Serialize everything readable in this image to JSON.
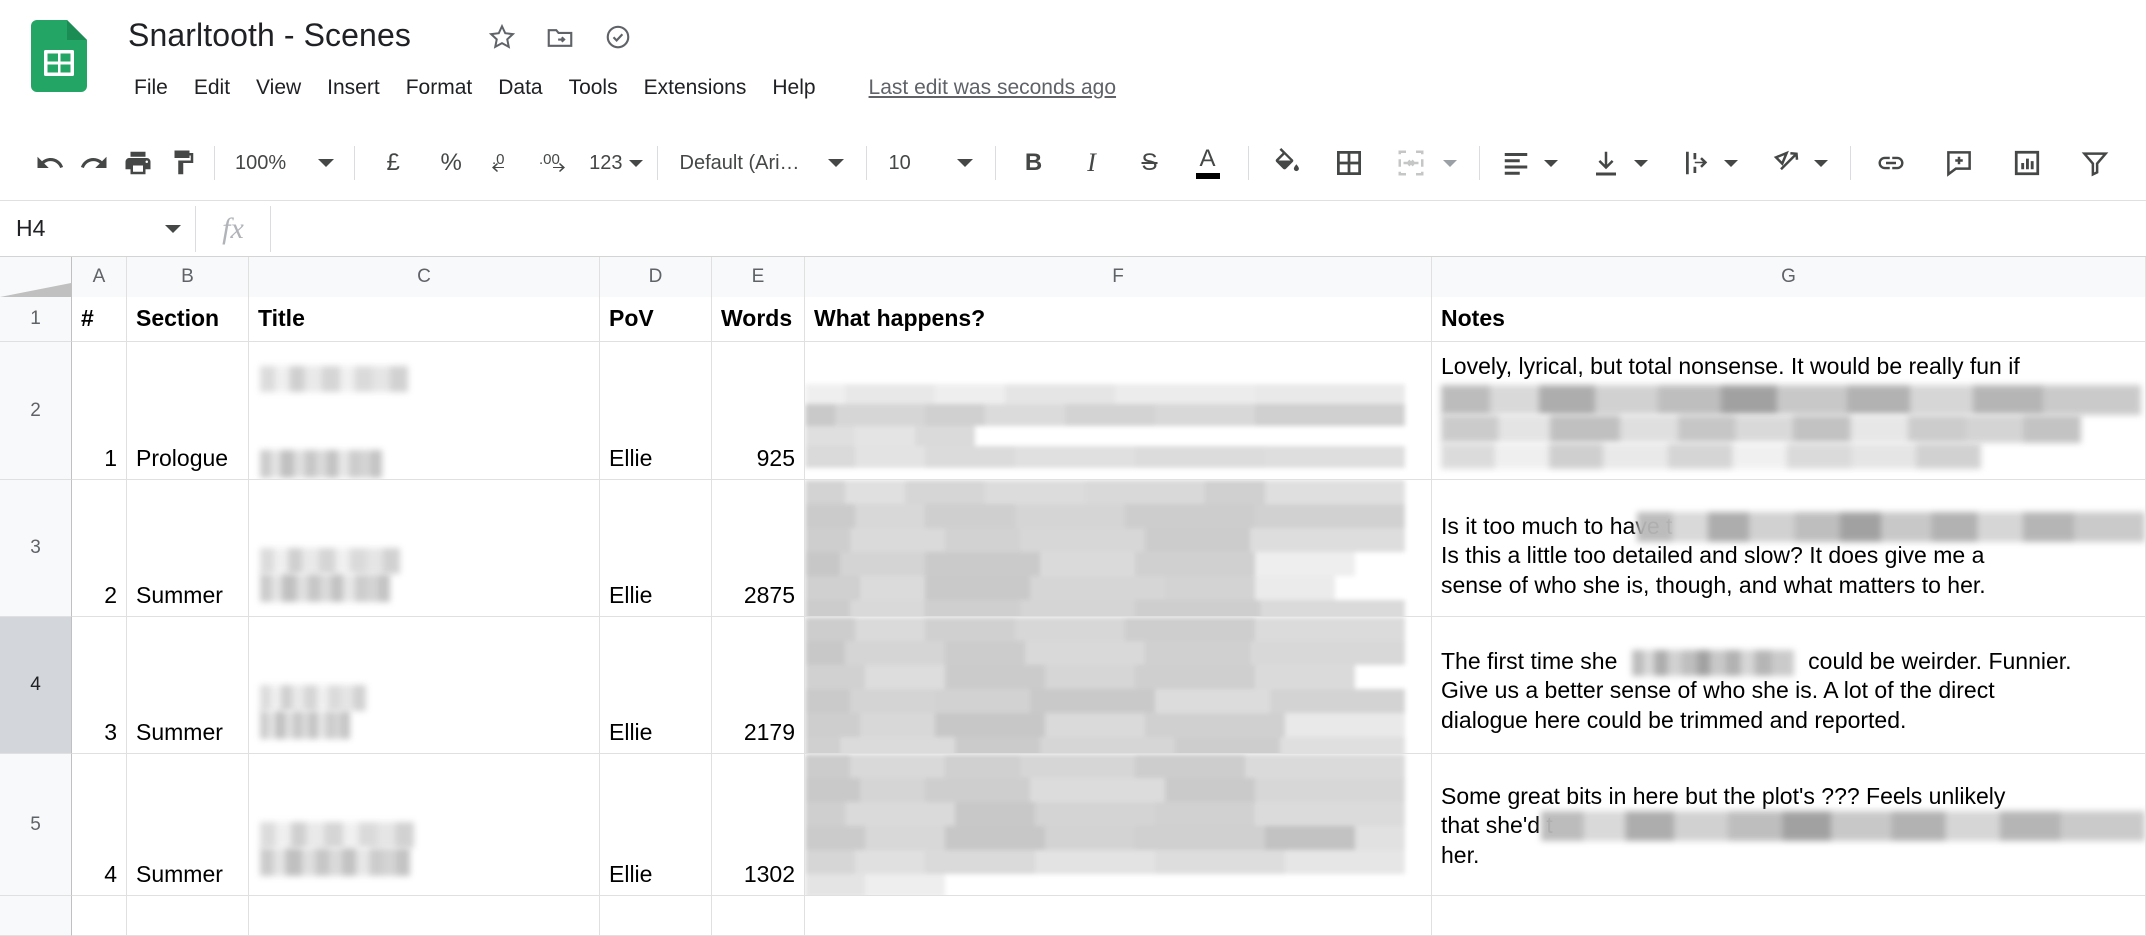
{
  "app": {
    "logo_icon": "google-sheets-icon",
    "title": "Snarltooth - Scenes",
    "title_icons": [
      {
        "name": "star-icon",
        "label": "Star"
      },
      {
        "name": "move-to-folder-icon",
        "label": "Move"
      },
      {
        "name": "cloud-saved-icon",
        "label": "Saved to Drive"
      }
    ],
    "menus": [
      "File",
      "Edit",
      "View",
      "Insert",
      "Format",
      "Data",
      "Tools",
      "Extensions",
      "Help"
    ],
    "last_edit": "Last edit was seconds ago"
  },
  "toolbar": {
    "undo": "undo-icon",
    "redo": "redo-icon",
    "print": "print-icon",
    "paint_format": "paint-format-icon",
    "zoom_value": "100%",
    "currency": "£",
    "percent": "%",
    "decrease_decimal": ".0",
    "increase_decimal": ".00",
    "number_format": "123",
    "font_family": "Default (Ari…",
    "font_size": "10",
    "bold": "B",
    "italic": "I",
    "strikethrough": "S",
    "text_color": "A",
    "fill_color": "fill-color-icon",
    "borders": "borders-icon",
    "merge_cells": "merge-cells-icon",
    "horizontal_align": "horizontal-align-icon",
    "vertical_align": "vertical-align-icon",
    "text_wrapping": "text-wrapping-icon",
    "text_rotation": "text-rotation-icon",
    "insert_link": "insert-link-icon",
    "insert_comment": "insert-comment-icon",
    "insert_chart": "insert-chart-icon",
    "create_filter": "create-filter-icon"
  },
  "formula_bar": {
    "cell_reference": "H4",
    "fx_label": "fx",
    "formula_value": ""
  },
  "sheet": {
    "column_letters": [
      "A",
      "B",
      "C",
      "D",
      "E",
      "F",
      "G"
    ],
    "row_numbers": [
      "1",
      "2",
      "3",
      "4",
      "5"
    ],
    "selected_row": "4",
    "headers": {
      "a": "#",
      "b": "Section",
      "c": "Title",
      "d": "PoV",
      "e": "Words",
      "f": "What happens?",
      "g": "Notes"
    },
    "rows": [
      {
        "row": "2",
        "num": "1",
        "section": "Prologue",
        "title": "",
        "pov": "Ellie",
        "words": "925",
        "what_happens": "",
        "notes_lines": [
          "Lovely, lyrical, but total nonsense. It would be really fun if",
          "",
          "",
          ""
        ],
        "notes_trailing": "."
      },
      {
        "row": "3",
        "num": "2",
        "section": "Summer",
        "title": "",
        "pov": "Ellie",
        "words": "2875",
        "what_happens": "",
        "notes_lines": [
          "Is it too much to have t",
          "Is this a little too detailed and slow? It does give me a",
          "sense of who she is, though, and what matters to her."
        ],
        "notes_trailing": ""
      },
      {
        "row": "4",
        "num": "3",
        "section": "Summer",
        "title": "",
        "pov": "Ellie",
        "words": "2179",
        "what_happens": "",
        "notes_lines": [
          "The first time she",
          "could be weirder. Funnier.",
          "Give us a better sense of who she is. A lot of the direct",
          "dialogue here could be trimmed and reported."
        ],
        "notes_trailing": ""
      },
      {
        "row": "5",
        "num": "4",
        "section": "Summer",
        "title": "",
        "pov": "Ellie",
        "words": "1302",
        "what_happens": "",
        "notes_lines": [
          "Some great bits in here but the plot's ??? Feels unlikely",
          "that she'd t",
          "her."
        ],
        "notes_trailing": ""
      }
    ]
  },
  "colors": {
    "brand_green": "#23A566",
    "header_bg": "#f8f9fa",
    "grid_line": "#e0e0e0",
    "text": "#202124",
    "muted_text": "#5f6368",
    "selected_row_bg": "#d3d6db"
  }
}
